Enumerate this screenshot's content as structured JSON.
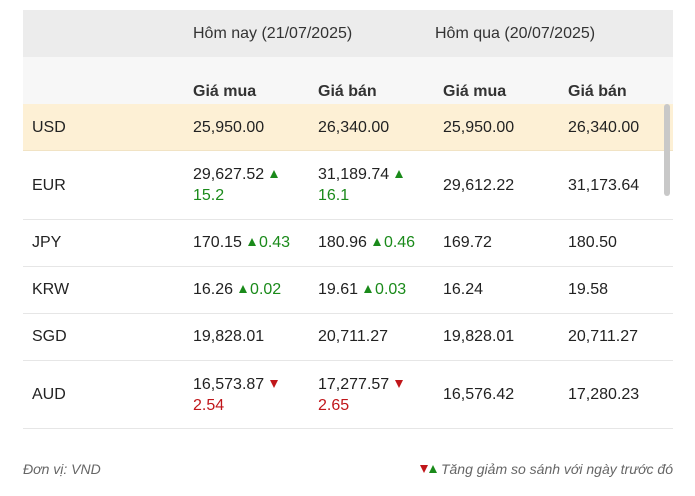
{
  "header": {
    "today": "Hôm nay (21/07/2025)",
    "yesterday": "Hôm qua (20/07/2025)",
    "buy": "Giá mua",
    "sell": "Giá bán"
  },
  "rows": [
    {
      "currency": "USD",
      "buy_today": "25,950.00",
      "sell_today": "26,340.00",
      "buy_yesterday": "25,950.00",
      "sell_yesterday": "26,340.00"
    },
    {
      "currency": "EUR",
      "buy_today": "29,627.52",
      "buy_change": "15.2",
      "sell_today": "31,189.74",
      "sell_change": "16.1",
      "buy_yesterday": "29,612.22",
      "sell_yesterday": "31,173.64"
    },
    {
      "currency": "JPY",
      "buy_today": "170.15",
      "buy_change": "0.43",
      "sell_today": "180.96",
      "sell_change": "0.46",
      "buy_yesterday": "169.72",
      "sell_yesterday": "180.50"
    },
    {
      "currency": "KRW",
      "buy_today": "16.26",
      "buy_change": "0.02",
      "sell_today": "19.61",
      "sell_change": "0.03",
      "buy_yesterday": "16.24",
      "sell_yesterday": "19.58"
    },
    {
      "currency": "SGD",
      "buy_today": "19,828.01",
      "sell_today": "20,711.27",
      "buy_yesterday": "19,828.01",
      "sell_yesterday": "20,711.27"
    },
    {
      "currency": "AUD",
      "buy_today": "16,573.87",
      "buy_change": "2.54",
      "sell_today": "17,277.57",
      "sell_change": "2.65",
      "buy_yesterday": "16,576.42",
      "sell_yesterday": "17,280.23"
    }
  ],
  "footer": {
    "unit": "Đơn vị: VND",
    "legend": "Tăng giảm so sánh với ngày trước đó"
  },
  "colors": {
    "up": "#1a8a1a",
    "down": "#c0161a",
    "highlight": "#fdf0d5"
  }
}
